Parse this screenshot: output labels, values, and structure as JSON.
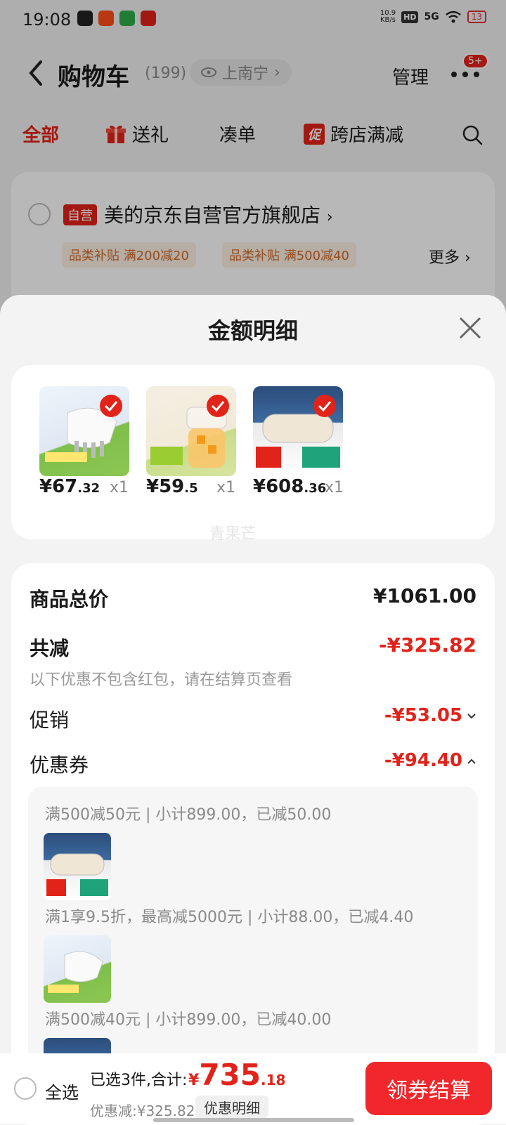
{
  "status": {
    "time": "19:08",
    "net_speed": "10.9",
    "net_unit": "KB/s",
    "hd": "HD",
    "signal": "5G",
    "battery": "13"
  },
  "header": {
    "title": "购物车",
    "count": "(199)",
    "location": "上南宁",
    "manage": "管理",
    "badge": "5+"
  },
  "tabs": {
    "all": "全部",
    "gift": "送礼",
    "combine": "凑单",
    "promo_tag": "促",
    "promo": "跨店满减"
  },
  "store": {
    "self_tag": "自营",
    "name": "美的京东自营官方旗舰店",
    "chip1": "品类补贴 满200减20",
    "chip2": "品类补贴 满500减40",
    "more": "更多"
  },
  "sheet": {
    "title": "金额明细",
    "products": [
      {
        "price_int": "¥67",
        "price_dec": ".32",
        "qty": "x1"
      },
      {
        "price_int": "¥59",
        "price_dec": ".5",
        "qty": "x1"
      },
      {
        "price_int": "¥608",
        "price_dec": ".36",
        "qty": "x1"
      }
    ],
    "watermark": "青果芒",
    "total_label": "商品总价",
    "total_value": "¥1061.00",
    "reduce_label": "共减",
    "reduce_value": "-¥325.82",
    "note": "以下优惠不包含红包，请在结算页查看",
    "promo_label": "促销",
    "promo_value": "-¥53.05",
    "coupon_label": "优惠券",
    "coupon_value": "-¥94.40",
    "coupon_lines": [
      "满500减50元 | 小计899.00，已减50.00",
      "满1享9.5折，最高减5000元 | 小计88.00，已减4.40",
      "满500减40元 | 小计899.00，已减40.00"
    ]
  },
  "bottom": {
    "select_all": "全选",
    "selected": "已选3件,合计:",
    "total_yen": "¥",
    "total_int": "735",
    "total_dec": ".18",
    "discount": "优惠减:¥325.82",
    "detail_btn": "优惠明细",
    "checkout": "领券结算"
  },
  "colors": {
    "accent": "#e2231a",
    "checkout": "#f1272c"
  }
}
